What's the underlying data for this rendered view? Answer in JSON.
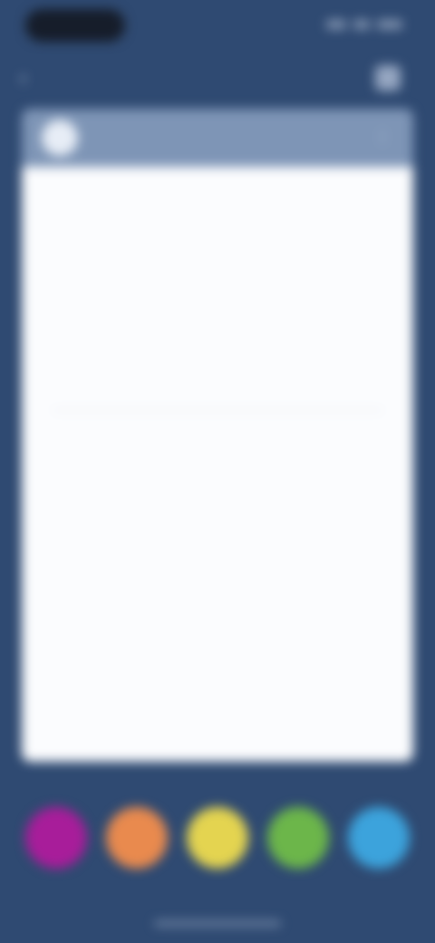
{
  "status_bar": {
    "time": ""
  },
  "top_bar": {
    "title": ""
  },
  "card": {
    "header_text": "",
    "doc": {
      "small_top": "",
      "title": "",
      "subtitle": "",
      "heading": "",
      "paragraph_1": "",
      "paragraph_2": "",
      "page_number": ""
    }
  },
  "caption": "",
  "colors": [
    {
      "name": "",
      "hex": "#a81d9a"
    },
    {
      "name": "",
      "hex": "#e98a4e"
    },
    {
      "name": "",
      "hex": "#e4d450"
    },
    {
      "name": "",
      "hex": "#6cb64a"
    },
    {
      "name": "",
      "hex": "#3ca3dc"
    }
  ]
}
